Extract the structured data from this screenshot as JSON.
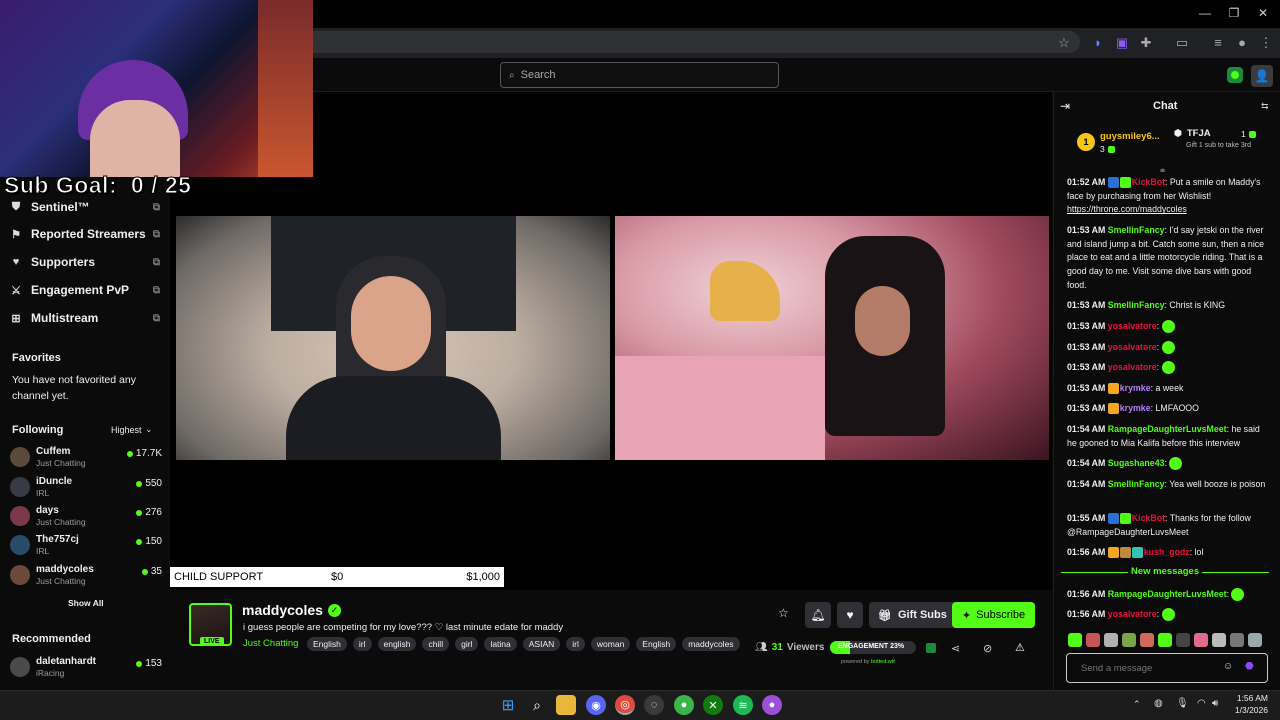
{
  "browser": {
    "icons": [
      "star-icon",
      "extension-icon",
      "puzzle-icon",
      "media-icon",
      "profile-icon",
      "menu-icon"
    ]
  },
  "header": {
    "search_placeholder": "Search"
  },
  "overlay": {
    "sub_goal": "Sub Goal:  0 / 25"
  },
  "sidebar": {
    "nav": [
      {
        "label": "Sentinel™",
        "icon": "shield-icon"
      },
      {
        "label": "Reported Streamers",
        "icon": "flag-icon"
      },
      {
        "label": "Supporters",
        "icon": "heart-icon"
      },
      {
        "label": "Engagement PvP",
        "icon": "swords-icon"
      },
      {
        "label": "Multistream",
        "icon": "grid-icon"
      }
    ],
    "favorites_title": "Favorites",
    "favorites_empty": "You have not favorited any channel yet.",
    "following_title": "Following",
    "sort_label": "Highest",
    "following": [
      {
        "name": "Cuffem",
        "category": "Just Chatting",
        "viewers": "17.7K",
        "color": "#5a4a3a"
      },
      {
        "name": "iDuncle",
        "category": "IRL",
        "viewers": "550",
        "color": "#3a3a46"
      },
      {
        "name": "days",
        "category": "Just Chatting",
        "viewers": "276",
        "color": "#7a3a4a"
      },
      {
        "name": "The757cj",
        "category": "IRL",
        "viewers": "150",
        "color": "#2a4a6a"
      },
      {
        "name": "maddycoles",
        "category": "Just Chatting",
        "viewers": "35",
        "color": "#6a4a3a"
      }
    ],
    "show_all": "Show All",
    "recommended_title": "Recommended",
    "recommended": [
      {
        "name": "daletanhardt",
        "category": "iRacing",
        "viewers": "153",
        "color": "#4a4a4a"
      }
    ]
  },
  "stream": {
    "goal_label": "CHILD SUPPORT",
    "goal_current": "$0",
    "goal_target": "$1,000",
    "live_label": "LIVE",
    "streamer": "maddycoles",
    "title": "i guess people are competing for my love??? ♡ last minute edate for maddy",
    "category": "Just Chatting",
    "tags": [
      "English",
      "irl",
      "english",
      "chill",
      "girl",
      "latina",
      "ASIAN",
      "irl",
      "woman",
      "English",
      "maddycoles"
    ],
    "viewers": "31",
    "viewers_label": "Viewers",
    "engagement": "ENGAGEMENT 23%",
    "engagement_level": 0.23,
    "powered_by": "powered by",
    "powered_brand": "botted.wtf",
    "gift_label": "Gift Subs",
    "subscribe_label": "Subscribe"
  },
  "chat": {
    "title": "Chat",
    "gifter_rank": "1",
    "gifter_name": "guysmiley6...",
    "gifter_count": "3",
    "second_name": "TFJA",
    "second_count": "1",
    "second_hint": "Gift 1 sub to take 3rd",
    "new_messages": "New messages",
    "input_placeholder": "Send a message",
    "messages": [
      {
        "time": "01:52 AM",
        "user": "KickBot",
        "color": "#e9113c",
        "text": ": Put a smile on Maddy's face by purchasing from her Wishlist! ",
        "link": "https://throne.com/maddycoles",
        "badges": [
          "#2c6fd9",
          "#53fc18"
        ]
      },
      {
        "time": "01:53 AM",
        "user": "SmellinFancy",
        "color": "#53fc18",
        "text": ": I'd say jetski on the river and island jump a bit. Catch some sun, then a nice place to eat and a little motorcycle riding. That is a good day to me. Visit some dive bars with good food.",
        "link": "",
        "badges": []
      },
      {
        "time": "01:53 AM",
        "user": "SmellinFancy",
        "color": "#53fc18",
        "text": ": Christ is KING",
        "link": "",
        "badges": []
      },
      {
        "time": "01:53 AM",
        "user": "yosalvatore",
        "color": "#e9113c",
        "text": ":",
        "emote": true,
        "link": "",
        "badges": []
      },
      {
        "time": "01:53 AM",
        "user": "yosalvatore",
        "color": "#e9113c",
        "text": ":",
        "emote": true,
        "link": "",
        "badges": []
      },
      {
        "time": "01:53 AM",
        "user": "yosalvatore",
        "color": "#e9113c",
        "text": ":",
        "emote": true,
        "link": "",
        "badges": []
      },
      {
        "time": "01:53 AM",
        "user": "krymke",
        "color": "#b77cff",
        "text": ": a week",
        "link": "",
        "badges": [
          "#f5a623"
        ]
      },
      {
        "time": "01:53 AM",
        "user": "krymke",
        "color": "#b77cff",
        "text": ": LMFAOOO",
        "link": "",
        "badges": [
          "#f5a623"
        ]
      },
      {
        "time": "01:54 AM",
        "user": "RampageDaughterLuvsMeet",
        "color": "#53fc18",
        "text": ": he said he gooned to Mia Kalifa before this interview",
        "link": "",
        "badges": []
      },
      {
        "time": "01:54 AM",
        "user": "Sugashane43",
        "color": "#53fc18",
        "text": ":",
        "emote": true,
        "link": "",
        "badges": []
      },
      {
        "time": "01:54 AM",
        "user": "SmellinFancy",
        "color": "#53fc18",
        "text": ": Yea well booze is poison",
        "link": "",
        "badges": []
      },
      {
        "time": "01:55 AM",
        "user": "KickBot",
        "color": "#e9113c",
        "text": ": Thanks for the follow @RampageDaughterLuvsMeet",
        "link": "",
        "badges": [
          "#2c6fd9",
          "#53fc18"
        ]
      },
      {
        "time": "01:56 AM",
        "user": "kush_godz",
        "color": "#e9113c",
        "text": ": lol",
        "link": "",
        "badges": [
          "#f5a623",
          "#c08a3e",
          "#2ec4b6"
        ]
      }
    ],
    "new_msgs": [
      {
        "time": "01:56 AM",
        "user": "RampageDaughterLuvsMeet",
        "color": "#53fc18",
        "text": ":",
        "emote": true
      },
      {
        "time": "01:56 AM",
        "user": "yosalvatore",
        "color": "#e9113c",
        "text": ":",
        "emote": true
      }
    ]
  },
  "taskbar": {
    "time": "1:56 AM",
    "date": "1/3/2026"
  }
}
